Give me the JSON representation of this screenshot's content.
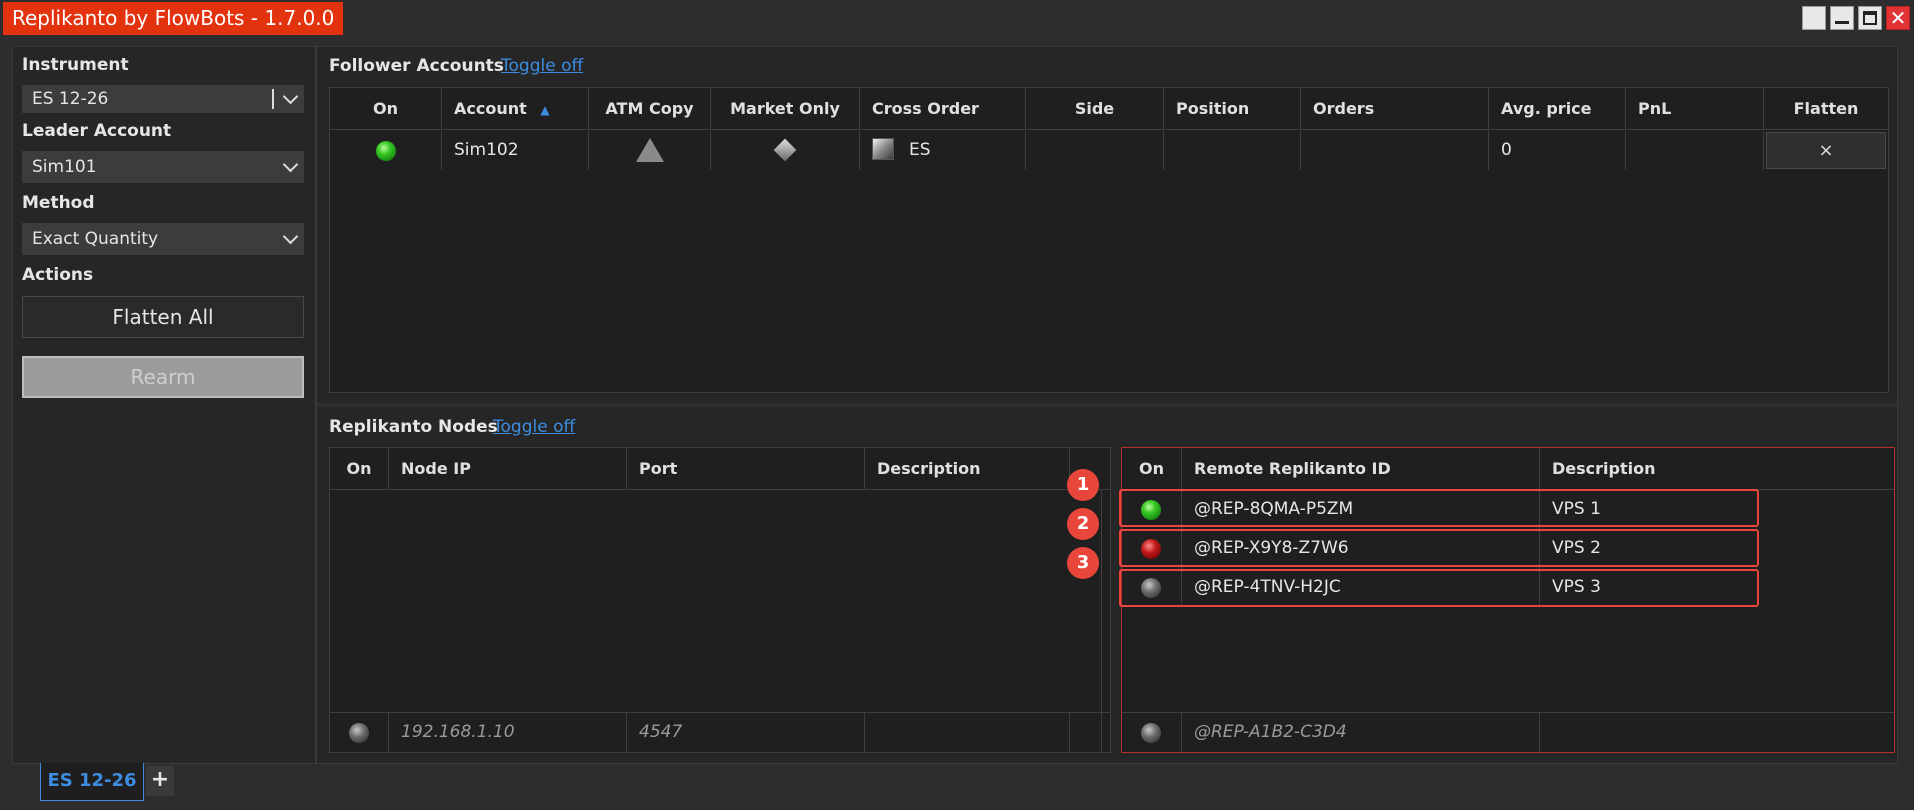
{
  "window": {
    "title": "Replikanto by FlowBots - 1.7.0.0",
    "close_glyph": "✕"
  },
  "sidebar": {
    "instrument_label": "Instrument",
    "instrument_value": "ES 12-26",
    "leader_label": "Leader Account",
    "leader_value": "Sim101",
    "method_label": "Method",
    "method_value": "Exact Quantity",
    "actions_label": "Actions",
    "flatten_all_label": "Flatten All",
    "rearm_label": "Rearm"
  },
  "followers": {
    "title": "Follower Accounts",
    "toggle_label": "Toggle off",
    "columns": [
      "On",
      "Account",
      "ATM Copy",
      "Market Only",
      "Cross Order",
      "Side",
      "Position",
      "Orders",
      "Avg. price",
      "PnL",
      "Flatten"
    ],
    "sort_indicator": "▲",
    "rows": [
      {
        "on": "green",
        "account": "Sim102",
        "cross_order": "ES",
        "side": "",
        "position": "",
        "orders": "",
        "avg_price": "0",
        "pnl": "",
        "flatten": "×"
      }
    ]
  },
  "nodes": {
    "title": "Replikanto Nodes",
    "toggle_label": "Toggle off",
    "local": {
      "columns": [
        "On",
        "Node IP",
        "Port",
        "Description"
      ],
      "footer": {
        "on": "gray",
        "node_ip": "192.168.1.10",
        "port": "4547",
        "description": ""
      }
    },
    "remote": {
      "columns": [
        "On",
        "Remote Replikanto ID",
        "Description"
      ],
      "rows": [
        {
          "on": "green",
          "id": "@REP-8QMA-P5ZM",
          "description": "VPS 1",
          "badge": "1"
        },
        {
          "on": "red",
          "id": "@REP-X9Y8-Z7W6",
          "description": "VPS 2",
          "badge": "2"
        },
        {
          "on": "gray",
          "id": "@REP-4TNV-H2JC",
          "description": "VPS 3",
          "badge": "3"
        }
      ],
      "footer": {
        "on": "gray",
        "id": "@REP-A1B2-C3D4",
        "description": ""
      }
    }
  },
  "tabs": {
    "active": "ES 12-26",
    "add_label": "+"
  },
  "colors": {
    "accent": "#3c8ce0",
    "title_bg": "#e2330e",
    "highlight": "#e8463a"
  }
}
